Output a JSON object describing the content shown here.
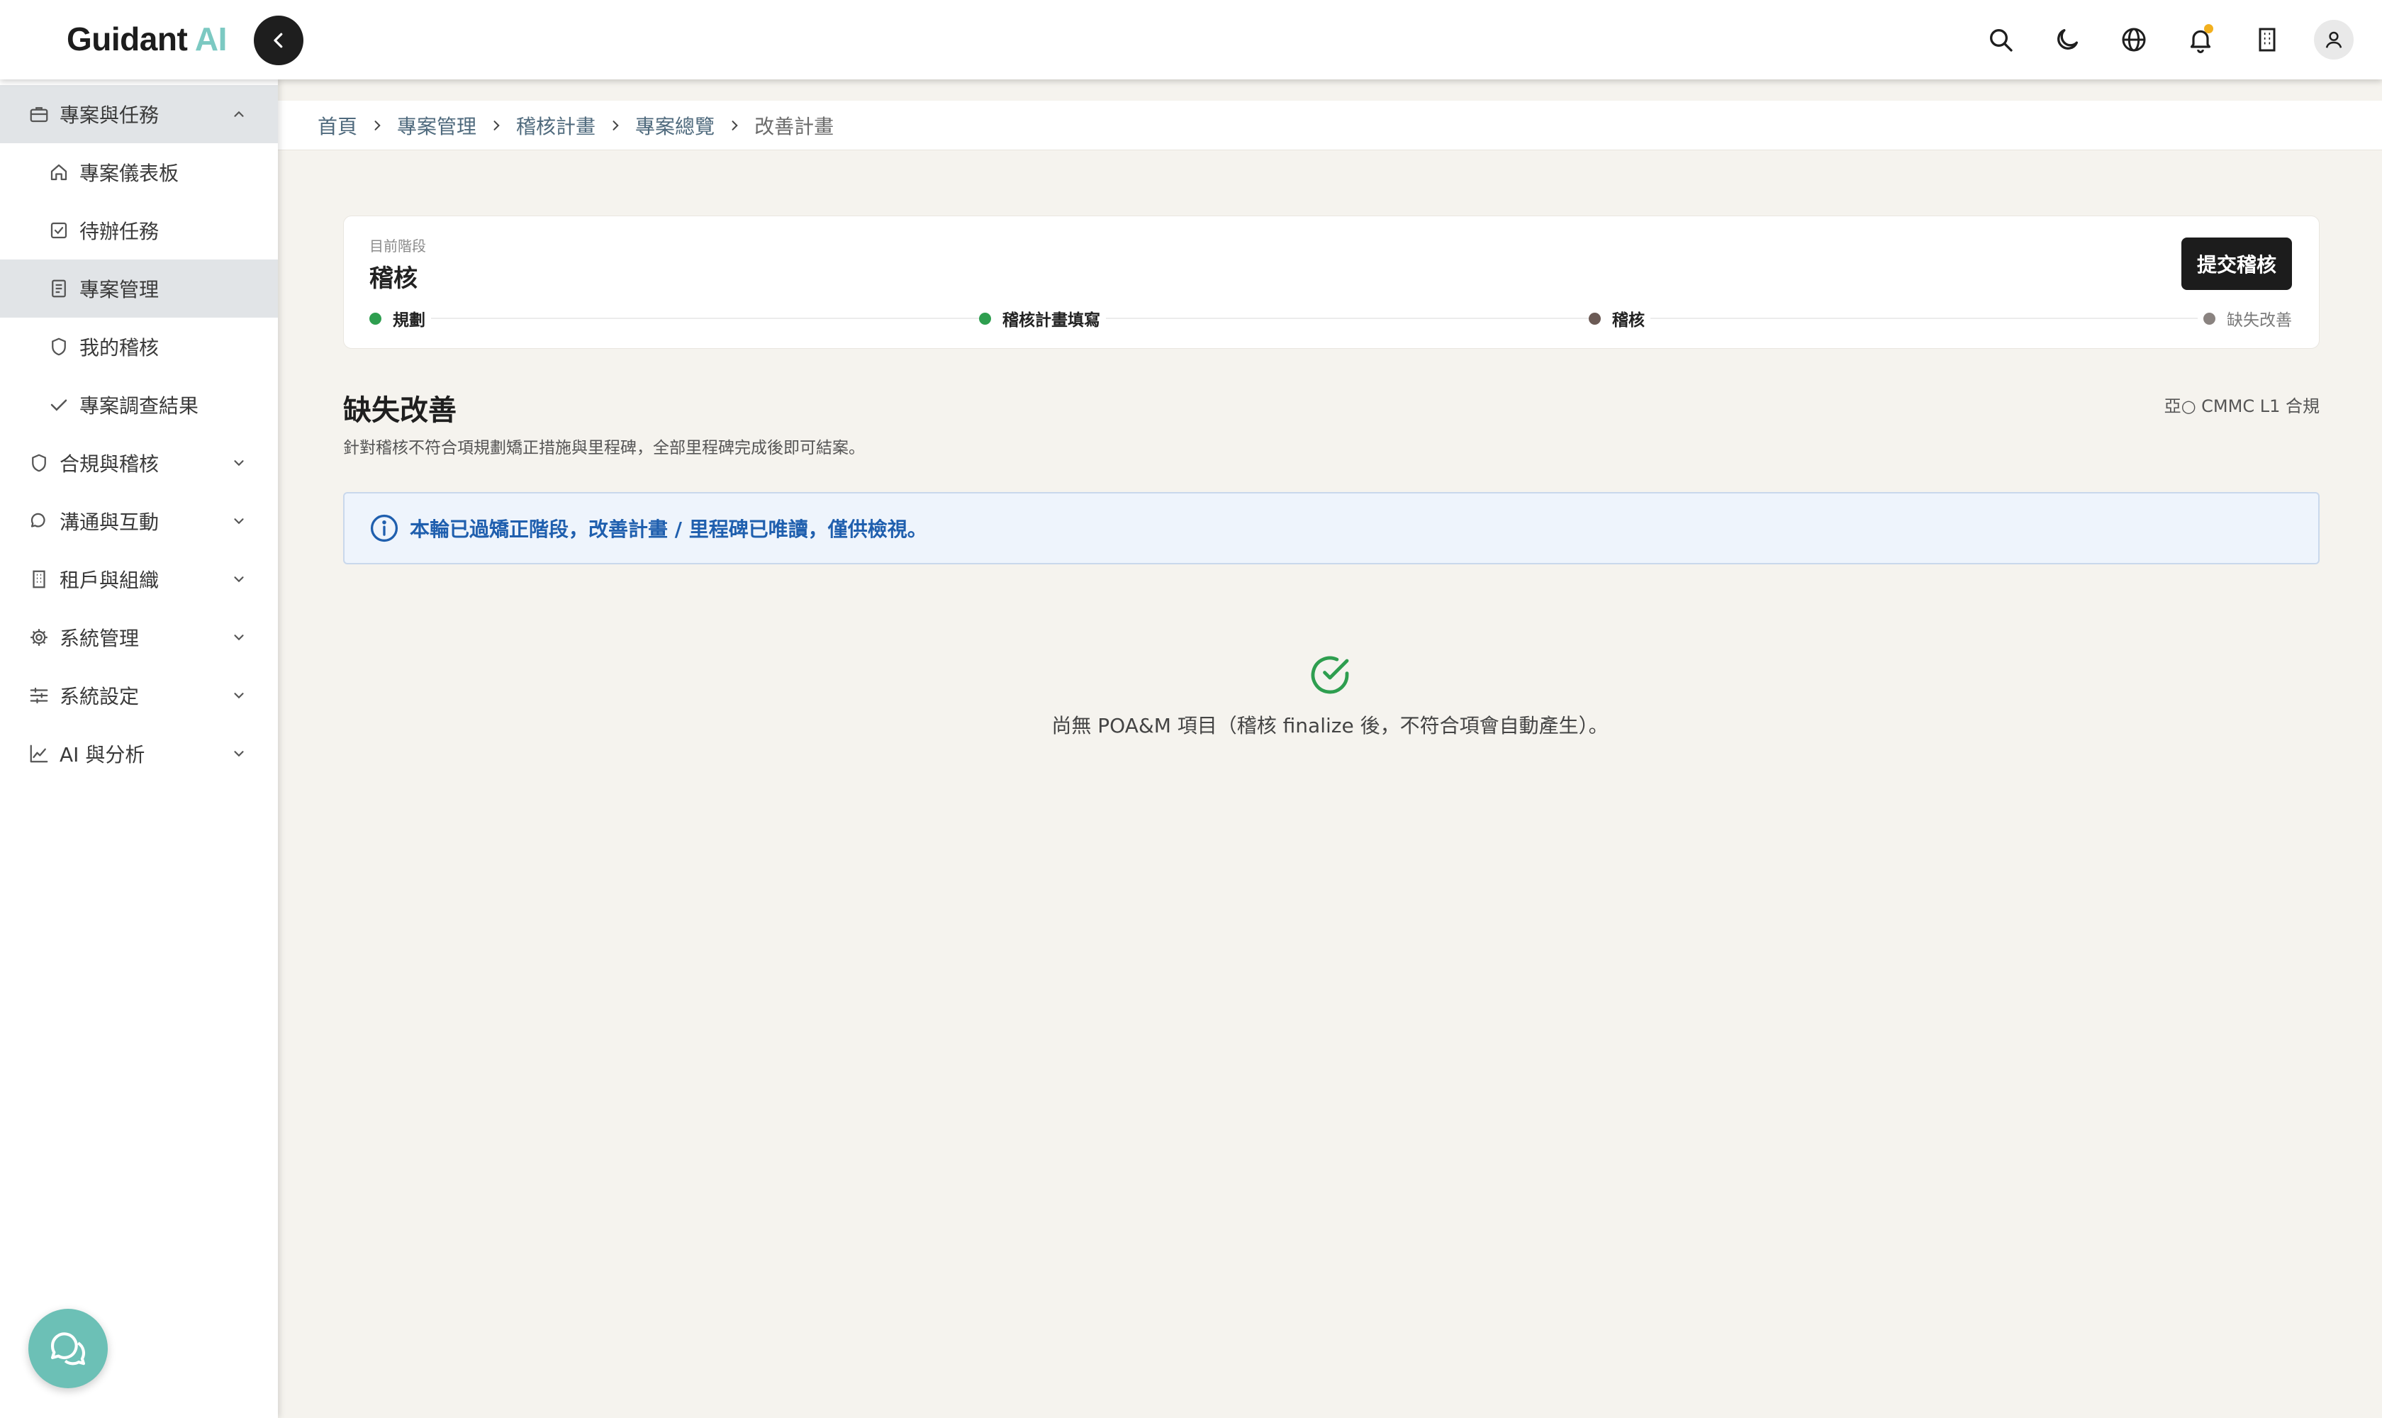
{
  "app": {
    "brand_name": "Guidant",
    "brand_suffix": "AI"
  },
  "header": {
    "icons": [
      "search-icon",
      "moon-icon",
      "globe-icon",
      "bell-icon",
      "building-icon",
      "user-icon"
    ],
    "has_notification": true
  },
  "sidebar": {
    "items": [
      {
        "label": "專案與任務",
        "icon": "briefcase-icon",
        "level": "group",
        "expanded": true
      },
      {
        "label": "專案儀表板",
        "icon": "home-icon",
        "level": "sub"
      },
      {
        "label": "待辦任務",
        "icon": "checkbox-icon",
        "level": "sub"
      },
      {
        "label": "專案管理",
        "icon": "document-icon",
        "level": "sub",
        "active": true
      },
      {
        "label": "我的稽核",
        "icon": "shield-icon",
        "level": "sub"
      },
      {
        "label": "專案調查結果",
        "icon": "check-icon",
        "level": "sub"
      },
      {
        "label": "合規與稽核",
        "icon": "shield-icon",
        "level": "group"
      },
      {
        "label": "溝通與互動",
        "icon": "chat-icon",
        "level": "group"
      },
      {
        "label": "租戶與組織",
        "icon": "building-icon",
        "level": "group"
      },
      {
        "label": "系統管理",
        "icon": "gear-icon",
        "level": "group"
      },
      {
        "label": "系統設定",
        "icon": "sliders-icon",
        "level": "group"
      },
      {
        "label": "AI 與分析",
        "icon": "chart-line-icon",
        "level": "group"
      }
    ]
  },
  "breadcrumb": [
    "首頁",
    "專案管理",
    "稽核計畫",
    "專案總覽",
    "改善計畫"
  ],
  "stage": {
    "label": "目前階段",
    "value": "稽核",
    "submit_label": "提交稽核",
    "steps": [
      {
        "label": "規劃",
        "status": "done",
        "color": "#2e9e4f"
      },
      {
        "label": "稽核計畫填寫",
        "status": "done",
        "color": "#2e9e4f"
      },
      {
        "label": "稽核",
        "status": "current",
        "color": "#6b5a55"
      },
      {
        "label": "缺失改善",
        "status": "pending",
        "color": "#8a8380"
      }
    ]
  },
  "section": {
    "title": "缺失改善",
    "description": "針對稽核不符合項規劃矯正措施與里程碑，全部里程碑完成後即可結案。",
    "framework": "亞○ CMMC L1 合規"
  },
  "info_banner": {
    "text": "本輪已過矯正階段，改善計畫 / 里程碑已唯讀，僅供檢視。"
  },
  "empty_state": {
    "text": "尚無 POA&M 項目（稽核 finalize 後，不符合項會自動產生）。"
  },
  "colors": {
    "accent_teal": "#6cc0b6",
    "success_green": "#2e9e4f",
    "info_blue": "#1f5fae",
    "notification_dot": "#f2b01e"
  }
}
